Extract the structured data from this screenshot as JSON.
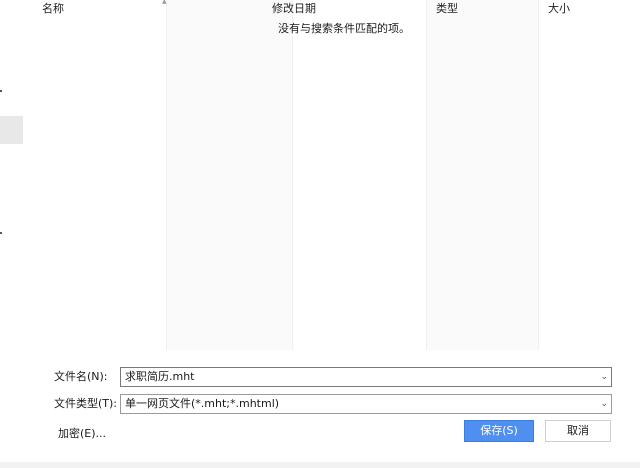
{
  "columns": {
    "name": "名称",
    "modified": "修改日期",
    "type": "类型",
    "size": "大小"
  },
  "empty_message": "没有与搜索条件匹配的项。",
  "filename": {
    "label": "文件名(N):",
    "value": "求职简历.mht"
  },
  "filetype": {
    "label": "文件类型(T):",
    "value": "单一网页文件(*.mht;*.mhtml)"
  },
  "hide_folders": "加密(E)...",
  "buttons": {
    "save": "保存(S)",
    "cancel": "取消"
  },
  "icons": {
    "sort": "sort-up-icon",
    "dropdown": "chevron-down-icon"
  }
}
